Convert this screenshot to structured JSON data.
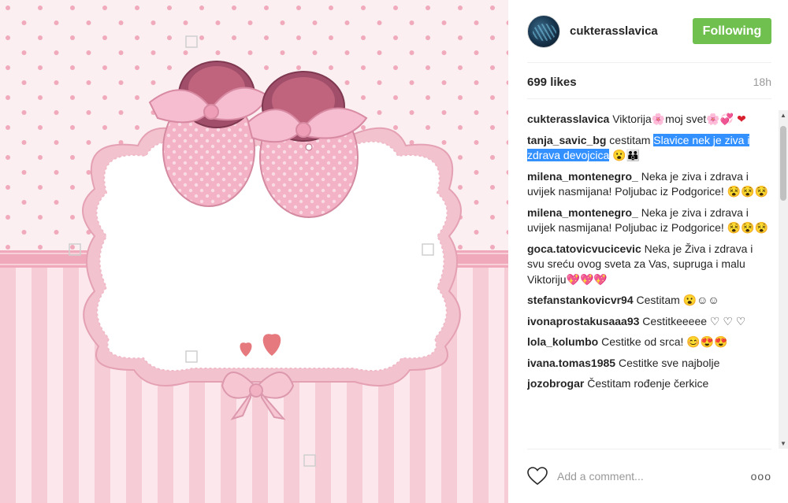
{
  "header": {
    "username": "cukterasslavica",
    "follow_label": "Following"
  },
  "stats": {
    "likes": "699 likes",
    "time": "18h"
  },
  "comments": [
    {
      "user": "cukterasslavica",
      "text": "Viktorija🌸moj svet🌸💞",
      "tail": "❤"
    },
    {
      "user": "tanja_savic_bg",
      "text": "cestitam",
      "highlight": "Slavice nek je ziva i zdrava devojcica",
      "tail": "😮👪"
    },
    {
      "user": "milena_montenegro_",
      "text": "Neka je ziva i zdrava i uvijek nasmijana! Poljubac iz Podgorice! 😵😵😵"
    },
    {
      "user": "milena_montenegro_",
      "text": "Neka je ziva i zdrava i uvijek nasmijana! Poljubac iz Podgorice! 😵😵😵"
    },
    {
      "user": "goca.tatovicvucicevic",
      "text": "Neka je Živa i zdrava i svu sreću ovog sveta za Vas, supruga i malu Viktoriju💖💖💖"
    },
    {
      "user": "stefanstankovicvr94",
      "text": "Cestitam 😮☺☺"
    },
    {
      "user": "ivonaprostakusaaa93",
      "text": "Cestitkeeeee ♡ ♡ ♡"
    },
    {
      "user": "lola_kolumbo",
      "text": "Cestitke od srca! 😊😍😍"
    },
    {
      "user": "ivana.tomas1985",
      "text": "Cestitke sve najbolje"
    },
    {
      "user": "jozobrogar",
      "text": "Čestitam rođenje čerkice"
    }
  ],
  "add_comment": {
    "placeholder": "Add a comment...",
    "more": "ooo"
  },
  "icons": {
    "heart": "heart-outline-icon",
    "more": "more-options-icon"
  },
  "colors": {
    "follow_green": "#70c050",
    "highlight_blue": "#3390ff",
    "image_pink": "#f4c7d1"
  }
}
